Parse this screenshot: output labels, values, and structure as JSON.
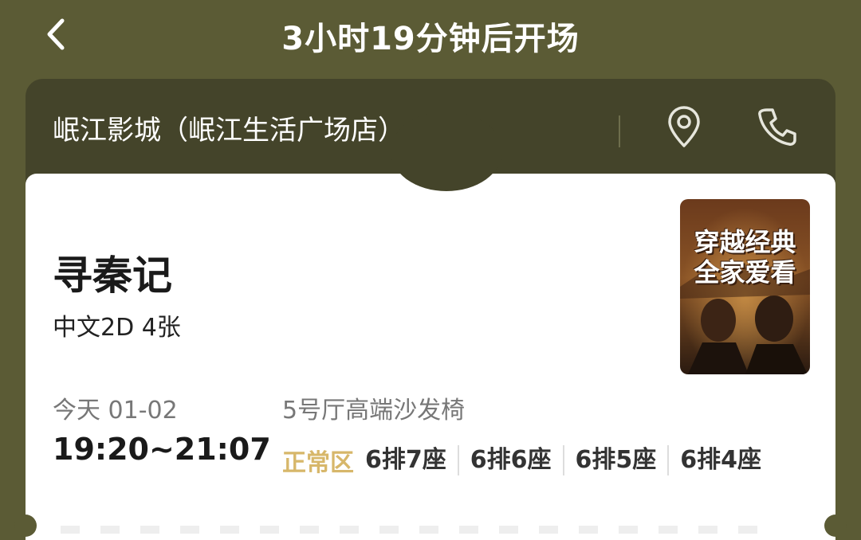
{
  "header": {
    "title": "3小时19分钟后开场"
  },
  "cinema": {
    "name": "岷江影城（岷江生活广场店）"
  },
  "movie": {
    "title": "寻秦记",
    "info": "中文2D 4张",
    "poster_text": [
      "穿越经典",
      "全家爱看"
    ]
  },
  "showtime": {
    "date": "今天 01-02",
    "time": "19:20~21:07",
    "hall": "5号厅高端沙发椅"
  },
  "seats": {
    "zone": "正常区",
    "list": [
      "6排7座",
      "6排6座",
      "6排5座",
      "6排4座"
    ]
  },
  "colors": {
    "background": "#5b5b35",
    "cinema_card": "#44442a",
    "zone_accent": "#d7b76a"
  },
  "icons": [
    "back-arrow-icon",
    "chevron-right-icon",
    "location-pin-icon",
    "phone-icon"
  ]
}
